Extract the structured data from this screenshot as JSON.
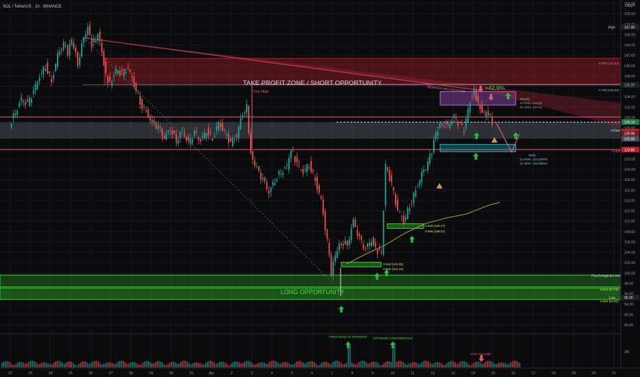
{
  "header": {
    "symbol_line": "SOL / TetherUS · 1h · BINANCE",
    "currency": "USDT"
  },
  "annotations": {
    "take_profit": "TAKE PROFIT ZONE / SHORT OPPORTUNITY",
    "long_opportunity": "LONG OPPORTUNITY",
    "key_high": "Key High",
    "bearish_megaphone": "BEARISH MEGAPHONE",
    "gain_pct": "+42.9%",
    "psych_level": "Psychological Level",
    "w_open": "wOpen",
    "d_open": "+Open",
    "first_sign": "FIRST SIGN OF INTEREST",
    "uptrend_confirmation": "UPTREND CONFIRMATION",
    "low_volume": "LOW VOLUME",
    "weekly_ema": "21 EMA: 129.00",
    "weekly_sma": "21 SMA: 127.01",
    "weekly_tag": "Weekly",
    "daily_tag": "Daily",
    "daily_ema": "21 EMA: 124.23978",
    "daily_sma": "21 SMA: 122.58619"
  },
  "fib_labels": {
    "f0886_top": "0.886 (141.63)",
    "f0786_top": "0.786 (136.30)",
    "f0618_mid": "0.618 (109.47)",
    "f0666_mid": "0.666 (108.57)",
    "f0618_low": "0.618 (102.05)",
    "f0666_low": "0.666 (101.19)",
    "f0618_bot": "0.618 (97.09)",
    "f0666_bot": "0.666 (94.92)"
  },
  "price_tags": {
    "high_label": "High",
    "high_value": "147.46",
    "low_label": "Low",
    "low_value": "95.26",
    "fib_top_tag": "136.30",
    "current": "129.13",
    "tag2": "127.29",
    "tag3": "126.96",
    "tag4": "125.90",
    "dopen_tag": "123.80",
    "volume_axis": "2M"
  },
  "colors": {
    "background": "#0b0b0e",
    "up": "#26a69a",
    "down": "#ef5350",
    "resistance_zone": "#b5202c",
    "support_zone": "#2fae25",
    "grey_band": "#4a4e57",
    "accent_green": "#4caf50",
    "megaphone": "#b0283a",
    "ema_line": "#a7a53a"
  },
  "chart_data": {
    "type": "line",
    "title": "SOL / TetherUS · 1h · BINANCE",
    "xlabel": "",
    "ylabel": "USDT",
    "ylim": [
      88,
      152
    ],
    "grid": true,
    "legend": "none",
    "y_ticks": [
      "90.00",
      "92.00",
      "94.00",
      "96.00",
      "98.00",
      "100.00",
      "102.00",
      "104.00",
      "106.00",
      "108.00",
      "110.00",
      "112.00",
      "114.00",
      "116.00",
      "118.00",
      "120.00",
      "122.00",
      "124.00",
      "126.00",
      "128.00",
      "130.00",
      "132.00",
      "134.00",
      "136.00",
      "138.00",
      "140.00",
      "142.00",
      "144.00",
      "146.00",
      "148.00",
      "150.00",
      "152.00"
    ],
    "x_ticks": [
      "22",
      "23",
      "24",
      "25",
      "26",
      "27",
      "28",
      "29",
      "30",
      "31",
      "Apr",
      "2",
      "3",
      "4",
      "5",
      "6",
      "7",
      "8",
      "9",
      "10",
      "11",
      "12",
      "13",
      "14",
      "15",
      "16",
      "17",
      "18",
      "19",
      "20",
      "21"
    ],
    "series": [
      {
        "values": [
          [
            0,
            128.5
          ],
          [
            0.3,
            131
          ],
          [
            0.6,
            133.5
          ],
          [
            0.9,
            132.5
          ],
          [
            1.2,
            135
          ],
          [
            1.5,
            138
          ],
          [
            1.8,
            140
          ],
          [
            2.1,
            137
          ],
          [
            2.4,
            142
          ],
          [
            2.7,
            144
          ],
          [
            2.9,
            142.5
          ],
          [
            3.1,
            145
          ],
          [
            3.4,
            140.5
          ],
          [
            3.7,
            145.5
          ],
          [
            3.9,
            147.5
          ],
          [
            4.1,
            144
          ],
          [
            4.4,
            146
          ],
          [
            4.6,
            142.5
          ],
          [
            4.8,
            138
          ],
          [
            5.0,
            136.5
          ],
          [
            5.3,
            139
          ],
          [
            5.6,
            138.5
          ],
          [
            5.9,
            139.5
          ],
          [
            6.2,
            136.5
          ],
          [
            6.5,
            133
          ],
          [
            6.8,
            131
          ],
          [
            7.1,
            129
          ],
          [
            7.4,
            128
          ],
          [
            7.7,
            126
          ],
          [
            8.0,
            128
          ],
          [
            8.3,
            125.5
          ],
          [
            8.6,
            127.5
          ],
          [
            8.9,
            125
          ],
          [
            9.2,
            127
          ],
          [
            9.5,
            125.5
          ],
          [
            9.8,
            127.5
          ],
          [
            10.1,
            126
          ],
          [
            10.4,
            129
          ],
          [
            10.7,
            127
          ],
          [
            11.0,
            125
          ],
          [
            11.3,
            126.5
          ],
          [
            11.6,
            131
          ],
          [
            11.8,
            132
          ],
          [
            12.0,
            123
          ],
          [
            12.3,
            120
          ],
          [
            12.6,
            118
          ],
          [
            12.9,
            115.5
          ],
          [
            13.2,
            118
          ],
          [
            13.5,
            119.5
          ],
          [
            13.8,
            120.5
          ],
          [
            14.0,
            124
          ],
          [
            14.3,
            121
          ],
          [
            14.6,
            119.5
          ],
          [
            14.9,
            121
          ],
          [
            15.2,
            118
          ],
          [
            15.5,
            114
          ],
          [
            15.8,
            106
          ],
          [
            16.0,
            100
          ],
          [
            16.2,
            103.5
          ],
          [
            16.5,
            106
          ],
          [
            16.8,
            105.5
          ],
          [
            17.1,
            110
          ],
          [
            17.4,
            106.5
          ],
          [
            17.7,
            104.5
          ],
          [
            18.0,
            106.5
          ],
          [
            18.2,
            104.5
          ],
          [
            18.5,
            104
          ],
          [
            18.7,
            121
          ],
          [
            19.0,
            117
          ],
          [
            19.3,
            112
          ],
          [
            19.6,
            110
          ],
          [
            19.9,
            113
          ],
          [
            20.2,
            116
          ],
          [
            20.5,
            119
          ],
          [
            20.8,
            121
          ],
          [
            21.0,
            123.5
          ],
          [
            21.2,
            127
          ],
          [
            21.5,
            129
          ],
          [
            21.8,
            128.5
          ],
          [
            22.1,
            130
          ],
          [
            22.4,
            128.5
          ],
          [
            22.6,
            127.5
          ],
          [
            22.9,
            133.5
          ],
          [
            23.1,
            135
          ],
          [
            23.3,
            132.5
          ],
          [
            23.6,
            130.5
          ],
          [
            23.8,
            131
          ],
          [
            24.0,
            129
          ]
        ]
      }
    ]
  }
}
